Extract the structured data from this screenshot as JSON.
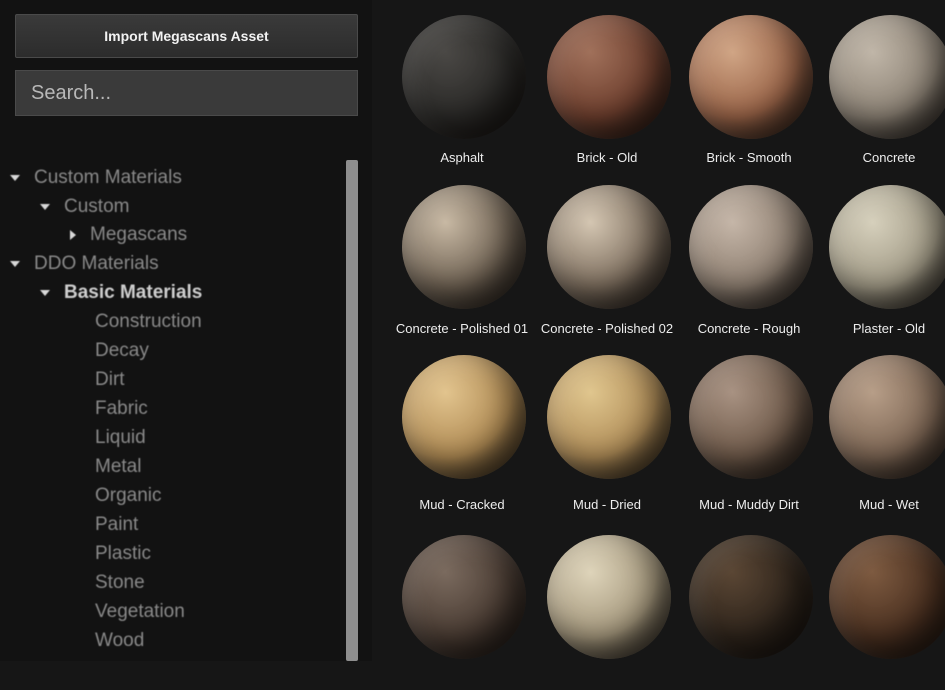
{
  "toolbar": {
    "import_label": "Import Megascans Asset"
  },
  "search": {
    "placeholder": "Search..."
  },
  "tree": [
    {
      "label": "Custom Materials",
      "expander": "expanded"
    },
    {
      "label": "Custom",
      "expander": "expanded"
    },
    {
      "label": "Megascans",
      "expander": "collapsed"
    },
    {
      "label": "DDO Materials",
      "expander": "expanded"
    },
    {
      "label": "Basic Materials",
      "expander": "expanded",
      "selected": true
    },
    {
      "label": "Construction",
      "expander": "none"
    },
    {
      "label": "Decay",
      "expander": "none"
    },
    {
      "label": "Dirt",
      "expander": "none"
    },
    {
      "label": "Fabric",
      "expander": "none"
    },
    {
      "label": "Liquid",
      "expander": "none"
    },
    {
      "label": "Metal",
      "expander": "none"
    },
    {
      "label": "Organic",
      "expander": "none"
    },
    {
      "label": "Paint",
      "expander": "none"
    },
    {
      "label": "Plastic",
      "expander": "none"
    },
    {
      "label": "Stone",
      "expander": "none"
    },
    {
      "label": "Vegetation",
      "expander": "none"
    },
    {
      "label": "Wood",
      "expander": "none"
    }
  ],
  "materials": [
    {
      "name": "Asphalt",
      "base": "#2b2a28",
      "light": "#4a4845"
    },
    {
      "name": "Brick - Old",
      "base": "#6e3f2e",
      "light": "#a0705a"
    },
    {
      "name": "Brick - Smooth",
      "base": "#9a6448",
      "light": "#d0a585"
    },
    {
      "name": "Concrete",
      "base": "#8c8275",
      "light": "#c0b6a8"
    },
    {
      "name": "Concrete - Polished 01",
      "base": "#6f6253",
      "light": "#c8b9a4"
    },
    {
      "name": "Concrete - Polished 02",
      "base": "#7d6e5e",
      "light": "#d4c6b2"
    },
    {
      "name": "Concrete - Rough",
      "base": "#8e7f71",
      "light": "#c5b6a8"
    },
    {
      "name": "Plaster - Old",
      "base": "#a19a86",
      "light": "#d6d0bc"
    },
    {
      "name": "Mud - Cracked",
      "base": "#b08b54",
      "light": "#e2c48e"
    },
    {
      "name": "Mud - Dried",
      "base": "#b08d58",
      "light": "#e0c68e"
    },
    {
      "name": "Mud - Muddy Dirt",
      "base": "#6f5a4a",
      "light": "#a89282"
    },
    {
      "name": "Mud - Wet",
      "base": "#7d6654",
      "light": "#b79e88"
    },
    {
      "name": "",
      "base": "#4a3c33",
      "light": "#7a6a5e"
    },
    {
      "name": "",
      "base": "#a4977c",
      "light": "#ded4ba"
    },
    {
      "name": "",
      "base": "#2e241b",
      "light": "#5a4634"
    },
    {
      "name": "",
      "base": "#4a3020",
      "light": "#7d5a40"
    }
  ]
}
